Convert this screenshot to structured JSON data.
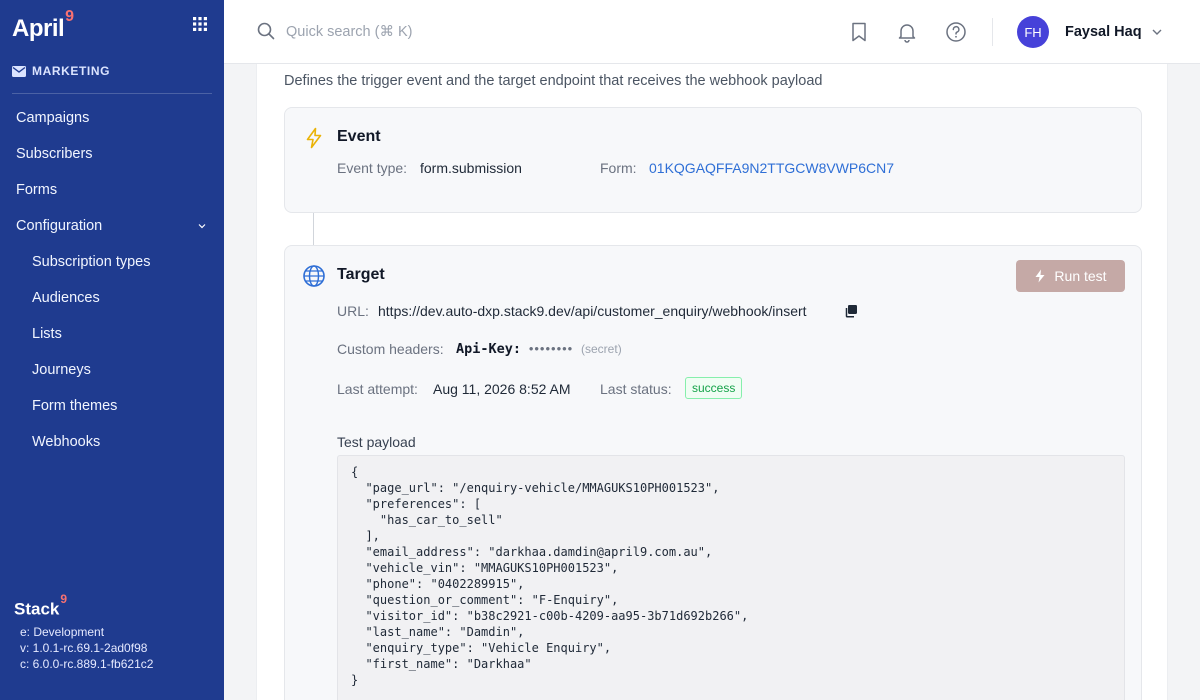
{
  "brand": {
    "name": "April",
    "mark": "9"
  },
  "sidebar": {
    "section": "MARKETING",
    "items": [
      {
        "label": "Campaigns",
        "sub": false
      },
      {
        "label": "Subscribers",
        "sub": false
      },
      {
        "label": "Forms",
        "sub": false
      },
      {
        "label": "Configuration",
        "sub": false,
        "expanded": true
      },
      {
        "label": "Subscription types",
        "sub": true
      },
      {
        "label": "Audiences",
        "sub": true
      },
      {
        "label": "Lists",
        "sub": true
      },
      {
        "label": "Journeys",
        "sub": true
      },
      {
        "label": "Form themes",
        "sub": true
      },
      {
        "label": "Webhooks",
        "sub": true
      }
    ],
    "footer": {
      "logo": "Stack",
      "mark": "9",
      "env": "e: Development",
      "version": "v: 1.0.1-rc.69.1-2ad0f98",
      "core": "c: 6.0.0-rc.889.1-fb621c2"
    }
  },
  "topbar": {
    "search_placeholder": "Quick search (⌘ K)",
    "user": {
      "initials": "FH",
      "name": "Faysal Haq"
    }
  },
  "main": {
    "description": "Defines the trigger event and the target endpoint that receives the webhook payload",
    "event": {
      "title": "Event",
      "event_type_label": "Event type",
      "event_type_value": "form.submission",
      "form_label": "Form",
      "form_value": "01KQGAQFFA9N2TTGCW8VWP6CN7"
    },
    "target": {
      "title": "Target",
      "run_test_label": "Run test",
      "url_label": "URL",
      "url_value": "https://dev.auto-dxp.stack9.dev/api/customer_enquiry/webhook/insert",
      "headers_label": "Custom headers",
      "header_key": "Api-Key:",
      "header_mask": "••••••••",
      "header_secret": "(secret)",
      "last_attempt_label": "Last attempt",
      "last_attempt_value": "Aug 11, 2026 8:52 AM",
      "last_status_label": "Last status",
      "last_status_value": "success",
      "payload_label": "Test payload",
      "payload_text": "{\n  \"page_url\": \"/enquiry-vehicle/MMAGUKS10PH001523\",\n  \"preferences\": [\n    \"has_car_to_sell\"\n  ],\n  \"email_address\": \"darkhaa.damdin@april9.com.au\",\n  \"vehicle_vin\": \"MMAGUKS10PH001523\",\n  \"phone\": \"0402289915\",\n  \"question_or_comment\": \"F-Enquiry\",\n  \"visitor_id\": \"b38c2921-c00b-4209-aa95-3b71d692b266\",\n  \"last_name\": \"Damdin\",\n  \"enquiry_type\": \"Vehicle Enquiry\",\n  \"first_name\": \"Darkhaa\"\n}"
    }
  },
  "colors": {
    "sidebar": "#1f3b8f",
    "accent_link": "#2f6fd6",
    "run_button": "#c5a9a6",
    "success": "#16a34a",
    "avatar": "#4641d9"
  }
}
